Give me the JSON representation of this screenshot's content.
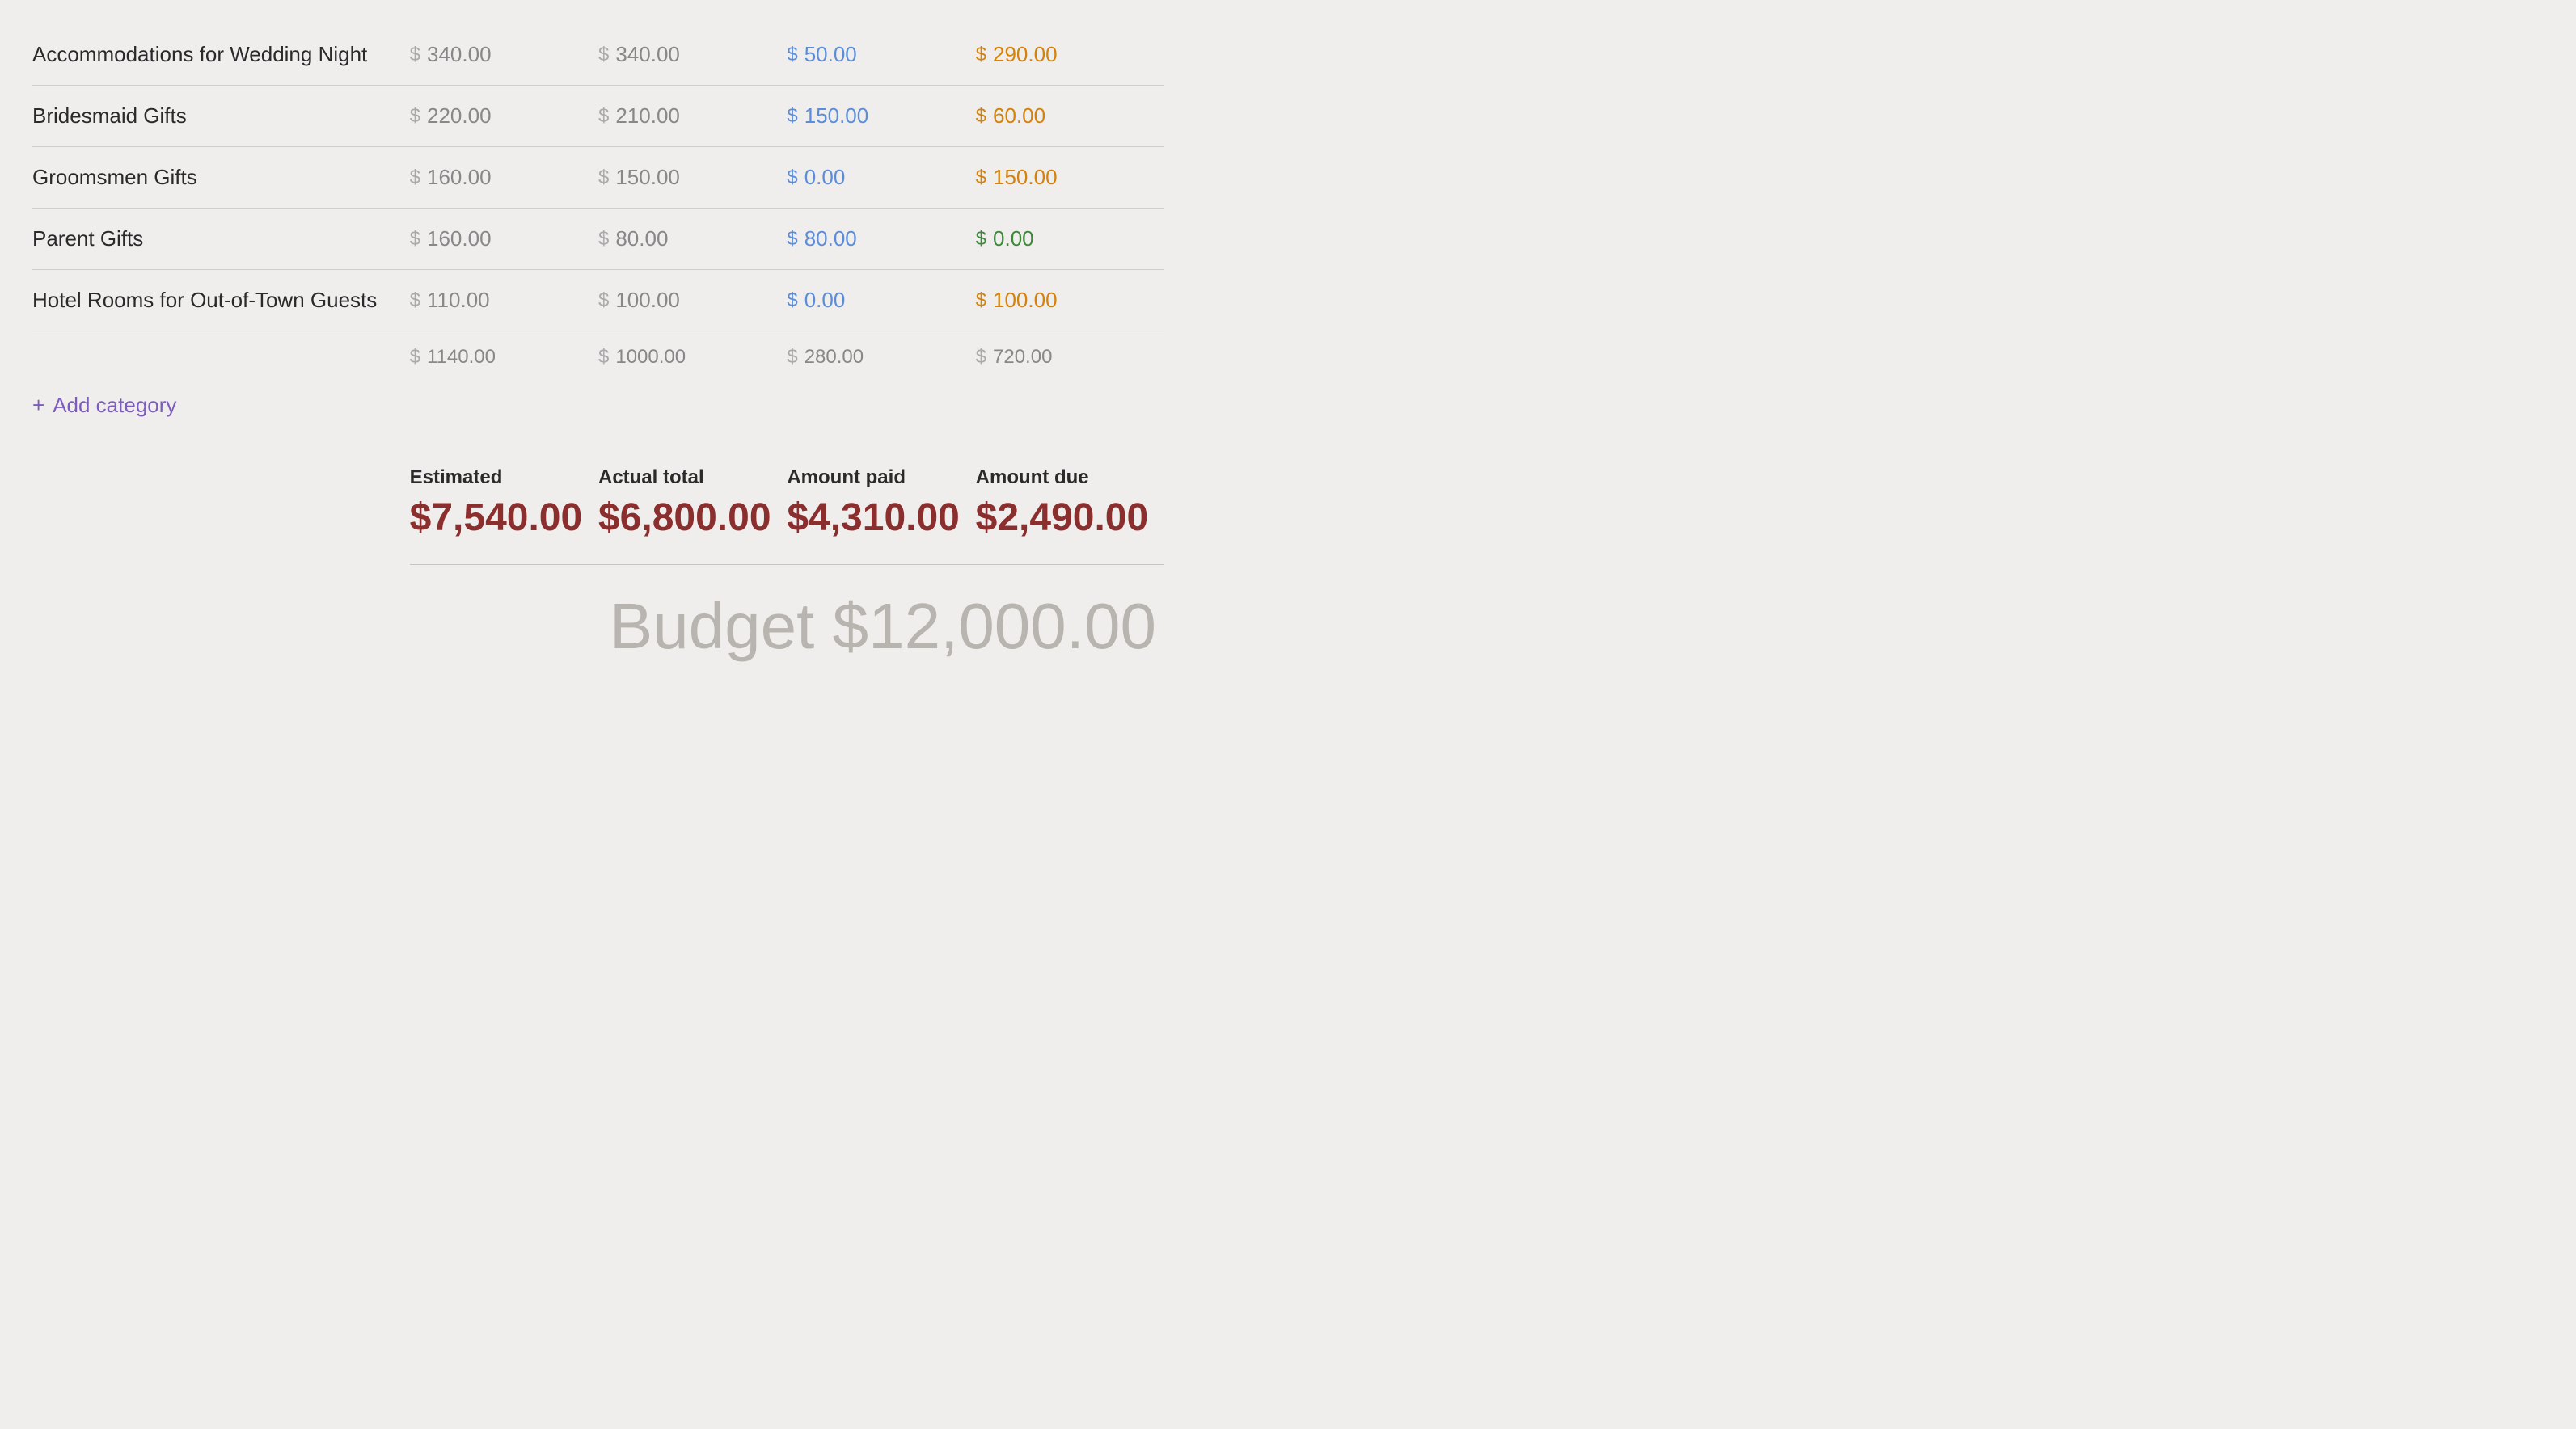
{
  "colors": {
    "blue": "#5b8dd9",
    "orange": "#d4820a",
    "green": "#3a8a3a",
    "purple": "#7c5cbf",
    "dark": "#2a2a2a",
    "gray": "#888888",
    "light_gray": "#b8b4b0",
    "dark_red": "#8b2e2e"
  },
  "rows": [
    {
      "name": "Accommodations for Wedding Night",
      "estimated": "340.00",
      "actual": "340.00",
      "paid": "50.00",
      "due": "290.00",
      "paid_color": "blue",
      "due_color": "orange"
    },
    {
      "name": "Bridesmaid Gifts",
      "estimated": "220.00",
      "actual": "210.00",
      "paid": "150.00",
      "due": "60.00",
      "paid_color": "blue",
      "due_color": "orange"
    },
    {
      "name": "Groomsmen Gifts",
      "estimated": "160.00",
      "actual": "150.00",
      "paid": "0.00",
      "due": "150.00",
      "paid_color": "blue",
      "due_color": "orange"
    },
    {
      "name": "Parent Gifts",
      "estimated": "160.00",
      "actual": "80.00",
      "paid": "80.00",
      "due": "0.00",
      "paid_color": "blue",
      "due_color": "green"
    },
    {
      "name": "Hotel Rooms for Out-of-Town Guests",
      "estimated": "110.00",
      "actual": "100.00",
      "paid": "0.00",
      "due": "100.00",
      "paid_color": "blue",
      "due_color": "orange"
    }
  ],
  "totals": {
    "estimated": "1140.00",
    "actual": "1000.00",
    "paid": "280.00",
    "due": "720.00"
  },
  "add_category_label": "Add category",
  "summary": {
    "estimated_label": "Estimated",
    "estimated_value": "$7,540.00",
    "actual_label": "Actual total",
    "actual_value": "$6,800.00",
    "paid_label": "Amount paid",
    "paid_value": "$4,310.00",
    "due_label": "Amount due",
    "due_value": "$2,490.00"
  },
  "budget": {
    "label": "Budget",
    "value": "$12,000.00",
    "display": "Budget $12,000.00"
  }
}
